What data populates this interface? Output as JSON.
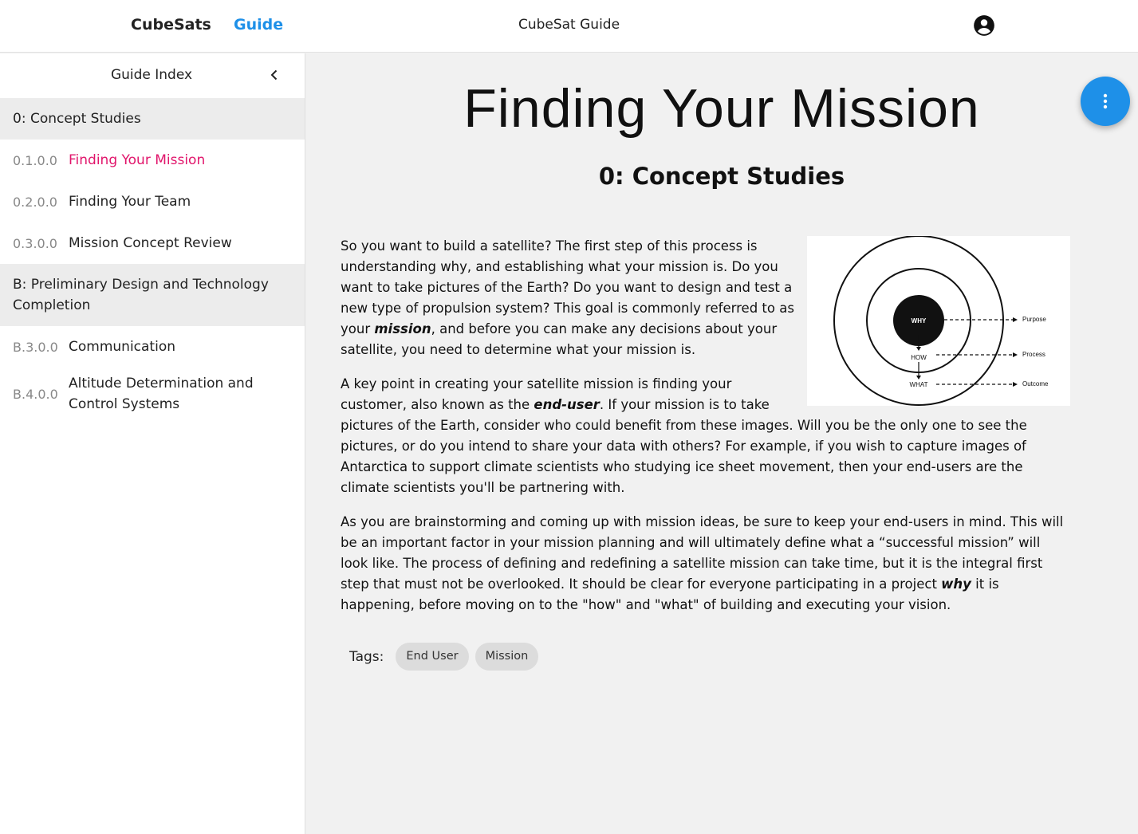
{
  "topbar": {
    "brand": "CubeSats",
    "nav_guide": "Guide",
    "title": "CubeSat Guide"
  },
  "sidebar": {
    "title": "Guide Index",
    "sections": [
      {
        "title": "0: Concept Studies",
        "items": [
          {
            "num": "0.1.0.0",
            "label": "Finding Your Mission",
            "active": true
          },
          {
            "num": "0.2.0.0",
            "label": "Finding Your Team"
          },
          {
            "num": "0.3.0.0",
            "label": "Mission Concept Review"
          }
        ]
      },
      {
        "title": "B: Preliminary Design and Technology Completion",
        "items": [
          {
            "num": "B.3.0.0",
            "label": "Communication"
          },
          {
            "num": "B.4.0.0",
            "label": "Altitude Determination and Control Systems"
          }
        ]
      }
    ]
  },
  "main": {
    "title": "Finding Your Mission",
    "subtitle": "0: Concept Studies",
    "paragraph1": {
      "before": "So you want to build a satellite? The first step of this process is understanding why, and establishing what your mission is. Do you want to take pictures of the Earth? Do you want to design and test a new type of propulsion system? This goal is commonly referred to as your ",
      "emphasis": "mission",
      "after": ", and before you can make any decisions about your satellite, you need to determine what your mission is."
    },
    "paragraph2": {
      "before": "A key point in creating your satellite mission is finding your customer, also known as the ",
      "emphasis": "end-user",
      "after": ". If your mission is to take pictures of the Earth, consider who could benefit from these images. Will you be the only one to see the pictures, or do you intend to share your data with others? For example, if you wish to capture images of Antarctica to support climate scientists who studying ice sheet movement, then your end-users are the climate scientists you'll be partnering with."
    },
    "paragraph3": {
      "before": "As you are brainstorming and coming up with mission ideas, be sure to keep your end-users in mind. This will be an important factor in your mission planning and will ultimately define what a “successful mission” will look like. The process of defining and redefining a satellite mission can take time, but it is the integral first step that must not be overlooked. It should be clear for everyone participating in a project ",
      "emphasis": "why",
      "after": " it is happening, before moving on to the \"how\" and \"what\" of building and executing your vision."
    },
    "diagram": {
      "why": "WHY",
      "how": "HOW",
      "what": "WHAT",
      "purpose": "Purpose",
      "process": "Process",
      "outcome": "Outcome"
    },
    "tags_label": "Tags:",
    "tags": [
      "End User",
      "Mission"
    ]
  },
  "icons": {
    "account": "account-circle-icon",
    "collapse": "chevron-left-icon",
    "fab": "more-vert-icon"
  },
  "colors": {
    "accent": "#1e90e8",
    "active_item": "#e1156b",
    "page_bg": "#f1f1f1"
  }
}
